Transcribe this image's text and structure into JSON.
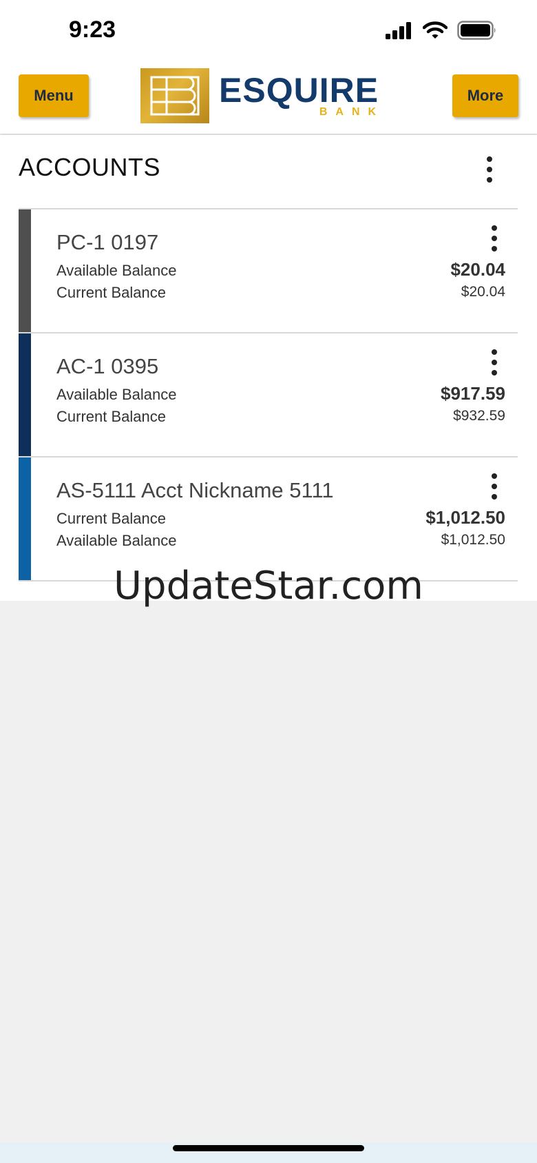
{
  "status_bar": {
    "time": "9:23"
  },
  "header": {
    "menu_label": "Menu",
    "more_label": "More",
    "logo_word": "ESQUIRE",
    "logo_sub": "BANK",
    "brand_color": "#123a6b",
    "accent_color": "#e8a800"
  },
  "accounts": {
    "title": "ACCOUNTS",
    "items": [
      {
        "name": "PC-1 0197",
        "label1": "Available Balance",
        "label2": "Current Balance",
        "amount1": "$20.04",
        "amount2": "$20.04",
        "accent": "#4f4f4f"
      },
      {
        "name": "AC-1 0395",
        "label1": "Available Balance",
        "label2": "Current Balance",
        "amount1": "$917.59",
        "amount2": "$932.59",
        "accent": "#0d2f5a"
      },
      {
        "name": "AS-5111 Acct Nickname 5111",
        "label1": "Current Balance",
        "label2": "Available Balance",
        "amount1": "$1,012.50",
        "amount2": "$1,012.50",
        "accent": "#0d62a6"
      }
    ]
  },
  "watermark": "UpdateStar.com"
}
